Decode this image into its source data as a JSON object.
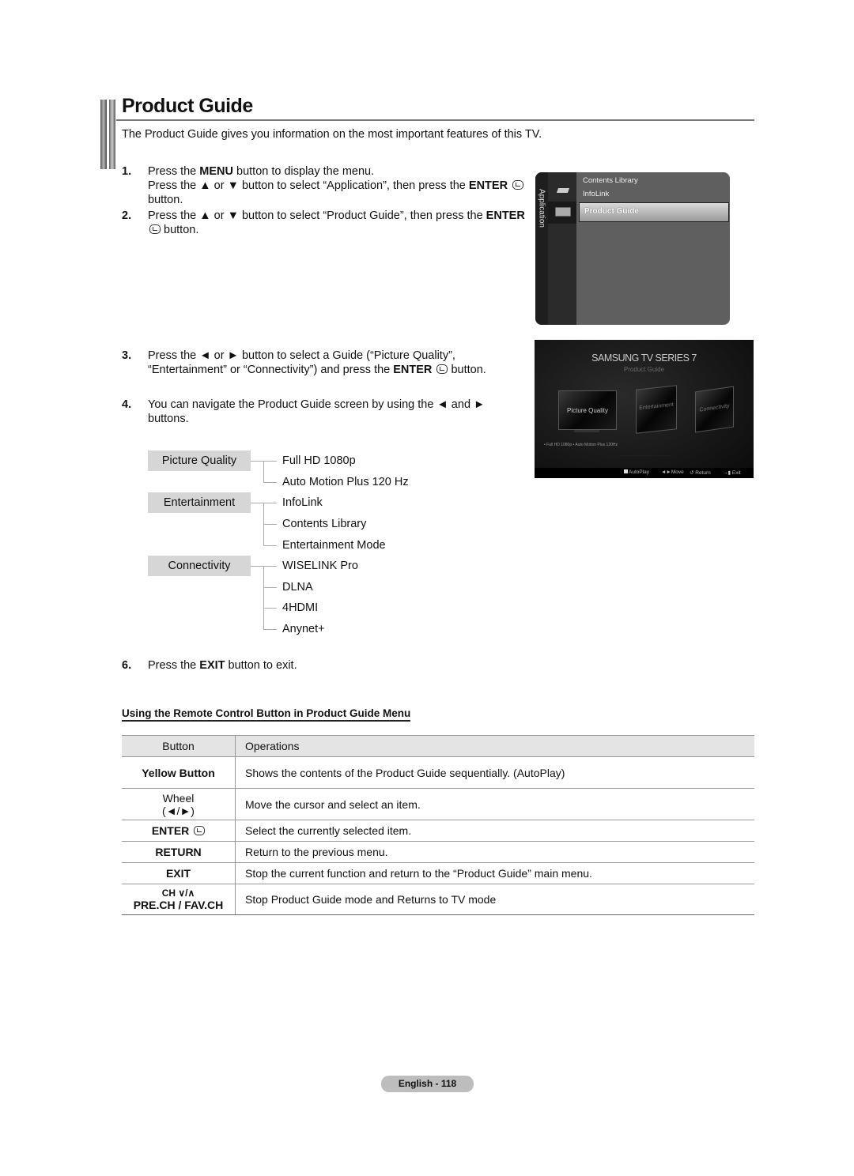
{
  "header": {
    "title": "Product Guide",
    "intro": "The Product Guide gives you information on the most important features of this TV."
  },
  "steps": [
    {
      "num": "1.",
      "line1_pre": "Press the ",
      "line1_bold": "MENU",
      "line1_post": " button to display the menu.",
      "line2_pre": "Press the ▲ or ▼ button to select “Application”, then press the ",
      "line2_bold": "ENTER",
      "line3": "button."
    },
    {
      "num": "2.",
      "line1_pre": "Press the ▲ or ▼ button to select “Product Guide”, then press the ",
      "line1_bold": "ENTER",
      "line2": " button."
    },
    {
      "num": "3.",
      "line1": "Press the ◄ or ► button to select a Guide (“Picture Quality”,",
      "line2_pre": "“Entertainment” or “Connectivity”) and press the ",
      "line2_bold": "ENTER",
      "line2_post": " button."
    },
    {
      "num": "4.",
      "line1": "You can navigate the Product Guide screen by using the ◄ and ►",
      "line2": "buttons."
    },
    {
      "num": "6.",
      "line1_pre": "Press the ",
      "line1_bold": "EXIT",
      "line1_post": " button to exit."
    }
  ],
  "tv_menu": {
    "category": "Application",
    "items": [
      "Contents Library",
      "InfoLink",
      "Product Guide"
    ],
    "selected": "Product Guide"
  },
  "guide_screen": {
    "brand": "SAMSUNG TV SERIES 7",
    "subtitle": "Product Guide",
    "guides": [
      "Picture Quality",
      "Entertainment",
      "Connectivity"
    ],
    "features_line": "• Full HD 1080p   • Auto Motion Plus 120Hz",
    "bottom_bar": {
      "autoplay": "AutoPlay",
      "move": "◄►Move",
      "return": "↺ Return",
      "exit": "→▮ Exit"
    }
  },
  "feature_tree": [
    {
      "category": "Picture Quality",
      "features": [
        "Full HD 1080p",
        "Auto Motion Plus 120 Hz"
      ]
    },
    {
      "category": "Entertainment",
      "features": [
        "InfoLink",
        "Contents Library",
        "Entertainment Mode"
      ]
    },
    {
      "category": "Connectivity",
      "features": [
        "WISELINK Pro",
        "DLNA",
        "4HDMI",
        "Anynet+"
      ]
    }
  ],
  "remote_section": {
    "heading": "Using the Remote Control Button in Product Guide Menu",
    "columns": [
      "Button",
      "Operations"
    ],
    "rows": [
      {
        "button": "Yellow Button",
        "operation": "Shows the contents of the Product Guide sequentially. (AutoPlay)"
      },
      {
        "button": "Wheel",
        "button2": "(◄/►)",
        "operation": "Move the cursor and select an item."
      },
      {
        "button": "ENTER",
        "operation": "Select the currently selected item."
      },
      {
        "button": "RETURN",
        "operation": "Return to the previous menu."
      },
      {
        "button": "EXIT",
        "operation": "Stop the current function and return to the “Product Guide” main menu."
      },
      {
        "button": "CH ∨/∧",
        "button2": "PRE.CH / FAV.CH",
        "operation": "Stop Product Guide mode and Returns to TV mode"
      }
    ]
  },
  "footer": {
    "page_label": "English - 118"
  }
}
